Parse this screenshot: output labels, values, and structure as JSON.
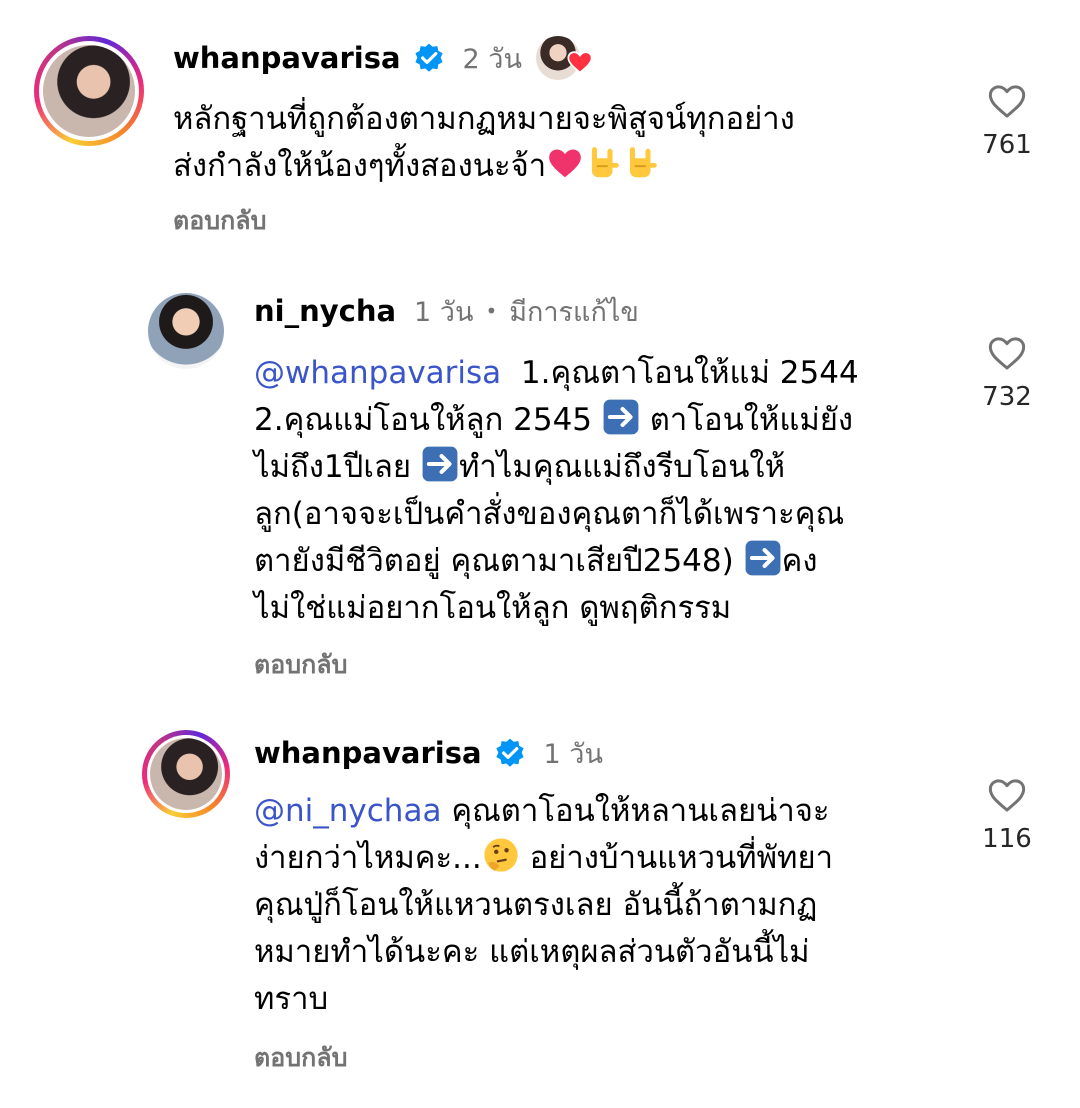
{
  "comments": [
    {
      "username": "whanpavarisa",
      "verified": true,
      "time": "2 วัน",
      "lines": [
        "หลักฐานที่ถูกต้องตามกฏหมายจะพิสูจน์ทุกอย่าง",
        "ส่งกำลังให้น้องๆทั้งสองนะจ้า"
      ],
      "reply_label": "ตอบกลับ",
      "likes": "761"
    },
    {
      "username": "ni_nycha",
      "verified": false,
      "time": "1 วัน",
      "edited": "มีการแก้ไข",
      "mention": "@whanpavarisa",
      "lines": [
        "1.คุณตาโอนให้แม่ 2544",
        "2.คุณแม่โอนให้ลูก 2545",
        "ตาโอนให้แม่ยัง",
        "ไม่ถึง1ปีเลย",
        "ทำไมคุณแม่ถึงรีบโอนให้",
        "ลูก(อาจจะเป็นคำสั่งของคุณตาก็ได้เพราะคุณ",
        "ตายังมีชีวิตอยู่ คุณตามาเสียปี2548)",
        "คง",
        "ไม่ใช่แม่อยากโอนให้ลูก ดูพฤติกรรม"
      ],
      "reply_label": "ตอบกลับ",
      "likes": "732"
    },
    {
      "username": "whanpavarisa",
      "verified": true,
      "time": "1 วัน",
      "mention": "@ni_nychaa",
      "lines": [
        "คุณตาโอนให้หลานเลยน่าจะ",
        "ง่ายกว่าไหมคะ...",
        "อย่างบ้านแหวนที่พัทยา",
        "คุณปู่ก็โอนให้แหวนตรงเลย อันนี้ถ้าตามกฏ",
        "หมายทำได้นะคะ แต่เหตุผลส่วนตัวอันนี้ไม่",
        "ทราบ"
      ],
      "reply_label": "ตอบกลับ",
      "likes": "116"
    }
  ],
  "colors": {
    "mention": "#3a55c9",
    "meta": "#737373",
    "verified": "#0095f6"
  }
}
